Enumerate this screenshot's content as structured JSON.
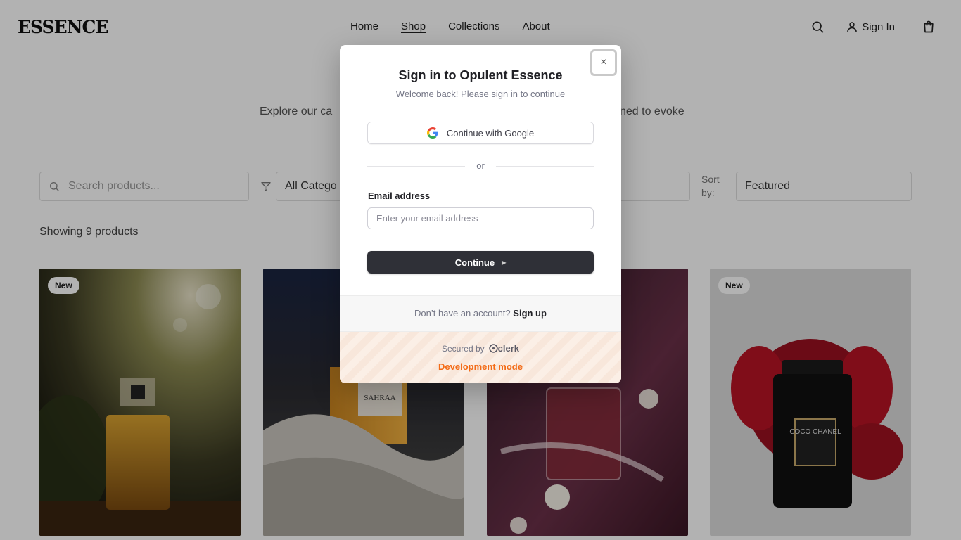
{
  "header": {
    "logo": "ESSENCE",
    "nav": [
      "Home",
      "Shop",
      "Collections",
      "About"
    ],
    "active_nav": "Shop",
    "sign_in": "Sign In"
  },
  "hero": {
    "subtitle_start": "Explore our ca",
    "subtitle_end": "ned to evoke"
  },
  "filters": {
    "search_placeholder": "Search products...",
    "category": "All Catego",
    "sort_label": "Sort by:",
    "sort_value": "Featured"
  },
  "product_count": "Showing 9 products",
  "products": [
    {
      "badge": "New"
    },
    {
      "badge": "",
      "bottle_label": "SAHRAA"
    },
    {
      "badge": ""
    },
    {
      "badge": "New",
      "bottle_label": "COCO CHANEL"
    }
  ],
  "modal": {
    "title": "Sign in to Opulent Essence",
    "subtitle": "Welcome back! Please sign in to continue",
    "google_button": "Continue with Google",
    "divider": "or",
    "email_label": "Email address",
    "email_placeholder": "Enter your email address",
    "continue_button": "Continue",
    "no_account": "Don’t have an account?",
    "sign_up": "Sign up",
    "secured_by": "Secured by",
    "clerk": "clerk",
    "dev_mode": "Development mode",
    "close": "×"
  },
  "colors": {
    "dev_mode": "#f36b16",
    "primary_button": "#2f3037"
  }
}
